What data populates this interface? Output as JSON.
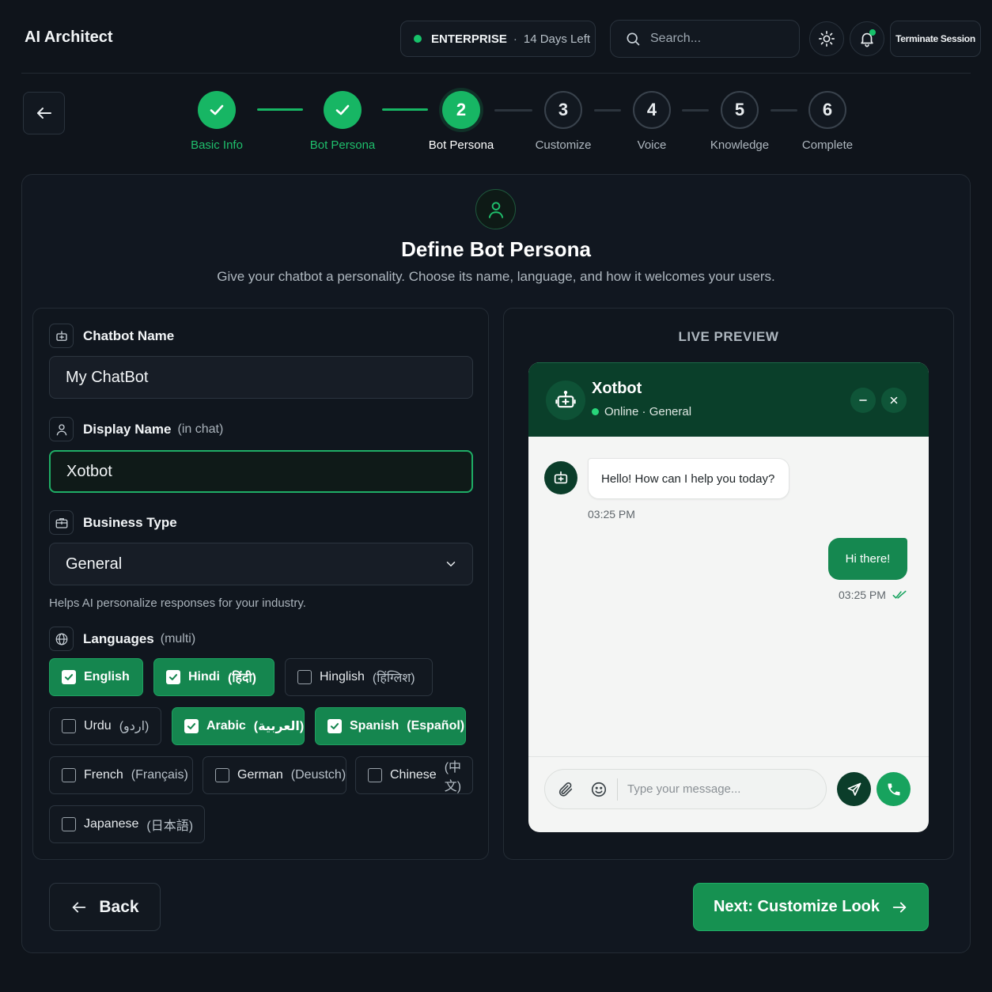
{
  "header": {
    "brand": "AI Architect",
    "plan_name": "ENTERPRISE",
    "plan_separator": "·",
    "plan_days": "14 Days Left",
    "search_placeholder": "Search...",
    "terminate_label": "Terminate Session",
    "accent_color": "#17b664"
  },
  "stepper": {
    "steps": [
      {
        "number": "1",
        "label": "Basic Info",
        "state": "done"
      },
      {
        "number": "2",
        "label": "Bot Persona",
        "state": "done"
      },
      {
        "number": "2",
        "label": "Bot Persona",
        "state": "active"
      },
      {
        "number": "3",
        "label": "Customize",
        "state": "todo"
      },
      {
        "number": "4",
        "label": "Voice",
        "state": "todo"
      },
      {
        "number": "5",
        "label": "Knowledge",
        "state": "todo"
      },
      {
        "number": "6",
        "label": "Complete",
        "state": "todo"
      }
    ]
  },
  "page": {
    "title": "Define Bot Persona",
    "subtitle": "Give your chatbot a personality. Choose its name, language, and how it welcomes your users."
  },
  "form": {
    "chatbot_name_label": "Chatbot Name",
    "chatbot_name_value": "My ChatBot",
    "display_name_label": "Display Name",
    "display_name_hint": "(in chat)",
    "display_name_value": "Xotbot",
    "business_type_label": "Business Type",
    "business_type_value": "General",
    "business_type_helper": "Helps AI personalize responses for your industry.",
    "languages_label": "Languages",
    "languages_hint": "(multi)",
    "languages": [
      {
        "name": "English",
        "native": "",
        "checked": true
      },
      {
        "name": "Hindi",
        "native": "(हिंदी)",
        "checked": true
      },
      {
        "name": "Hinglish",
        "native": "(हिंग्लिश)",
        "checked": false
      },
      {
        "name": "Urdu",
        "native": "(اردو)",
        "checked": false
      },
      {
        "name": "Arabic",
        "native": "(العربية)",
        "checked": true
      },
      {
        "name": "Spanish",
        "native": "(Español)",
        "checked": true
      },
      {
        "name": "French",
        "native": "(Français)",
        "checked": false
      },
      {
        "name": "German",
        "native": "(Deustch)",
        "checked": false
      },
      {
        "name": "Chinese",
        "native": "(中文)",
        "checked": false
      },
      {
        "name": "Japanese",
        "native": "(日本語)",
        "checked": false
      }
    ]
  },
  "preview": {
    "label": "LIVE PREVIEW",
    "bot_name": "Xotbot",
    "status": "Online · General",
    "bot_message": "Hello! How can I help you today?",
    "bot_time": "03:25 PM",
    "user_message": "Hi there!",
    "user_time": "03:25 PM",
    "input_placeholder": "Type your message..."
  },
  "footer": {
    "back_label": "Back",
    "next_label": "Next: Customize Look"
  }
}
